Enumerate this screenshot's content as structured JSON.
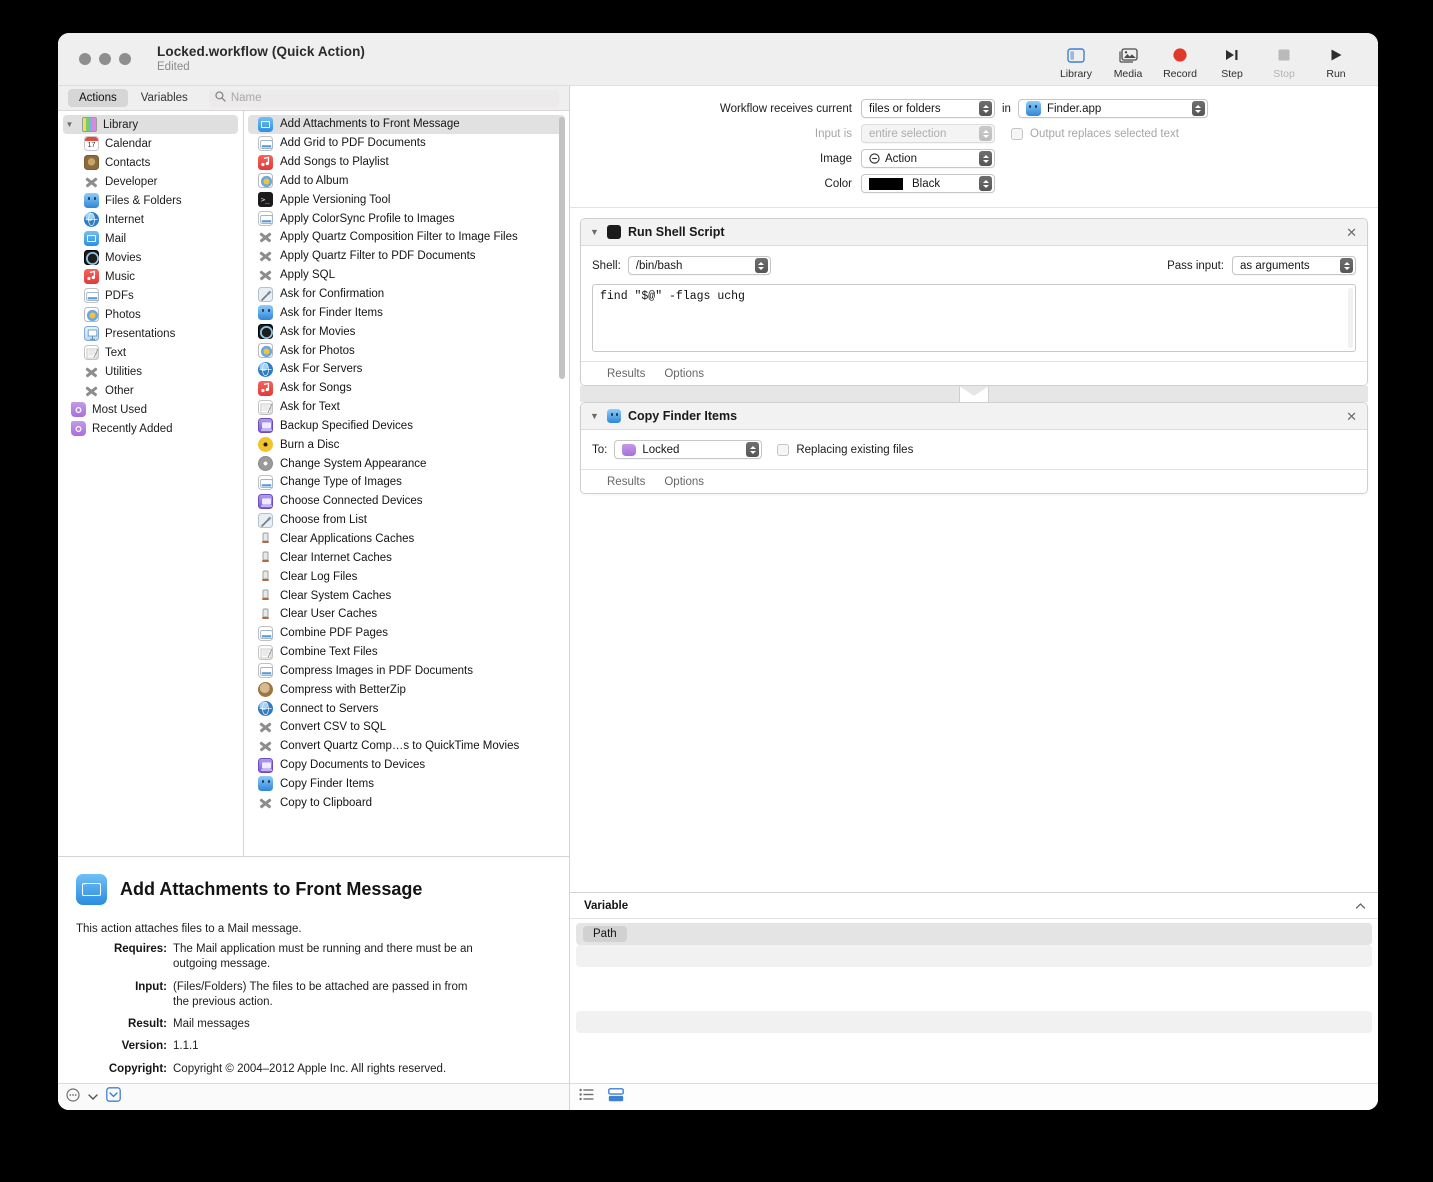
{
  "window": {
    "title": "Locked.workflow (Quick Action)",
    "subtitle": "Edited"
  },
  "toolbar": [
    {
      "label": "Library",
      "icon": "library-icon",
      "disabled": false
    },
    {
      "label": "Media",
      "icon": "media-icon",
      "disabled": false
    },
    {
      "label": "Record",
      "icon": "record-icon",
      "disabled": false
    },
    {
      "label": "Step",
      "icon": "step-icon",
      "disabled": false
    },
    {
      "label": "Stop",
      "icon": "stop-icon",
      "disabled": true
    },
    {
      "label": "Run",
      "icon": "run-icon",
      "disabled": false
    }
  ],
  "tabs": {
    "actions": "Actions",
    "variables": "Variables"
  },
  "search": {
    "placeholder": "Name",
    "value": ""
  },
  "tree": {
    "root": {
      "label": "Library",
      "icon": "library-icon"
    },
    "children": [
      {
        "label": "Calendar",
        "icon": "calendar-icon"
      },
      {
        "label": "Contacts",
        "icon": "contacts-icon"
      },
      {
        "label": "Developer",
        "icon": "x-tool-icon"
      },
      {
        "label": "Files & Folders",
        "icon": "finder-icon"
      },
      {
        "label": "Internet",
        "icon": "globe-icon"
      },
      {
        "label": "Mail",
        "icon": "mail-icon"
      },
      {
        "label": "Movies",
        "icon": "quicktime-icon"
      },
      {
        "label": "Music",
        "icon": "music-icon"
      },
      {
        "label": "PDFs",
        "icon": "pdf-icon"
      },
      {
        "label": "Photos",
        "icon": "photos-icon"
      },
      {
        "label": "Presentations",
        "icon": "presentation-icon"
      },
      {
        "label": "Text",
        "icon": "textedit-icon"
      },
      {
        "label": "Utilities",
        "icon": "x-tool-icon"
      },
      {
        "label": "Other",
        "icon": "x-tool-icon"
      }
    ],
    "groups": [
      {
        "label": "Most Used",
        "icon": "smart-folder-icon"
      },
      {
        "label": "Recently Added",
        "icon": "smart-folder-icon"
      }
    ]
  },
  "actions_list": [
    {
      "label": "Add Attachments to Front Message",
      "icon": "mail-icon",
      "selected": true
    },
    {
      "label": "Add Grid to PDF Documents",
      "icon": "pdf-icon"
    },
    {
      "label": "Add Songs to Playlist",
      "icon": "music-icon"
    },
    {
      "label": "Add to Album",
      "icon": "photos-icon"
    },
    {
      "label": "Apple Versioning Tool",
      "icon": "terminal-icon"
    },
    {
      "label": "Apply ColorSync Profile to Images",
      "icon": "pdf-icon"
    },
    {
      "label": "Apply Quartz Composition Filter to Image Files",
      "icon": "x-tool-icon"
    },
    {
      "label": "Apply Quartz Filter to PDF Documents",
      "icon": "x-tool-icon"
    },
    {
      "label": "Apply SQL",
      "icon": "x-tool-icon"
    },
    {
      "label": "Ask for Confirmation",
      "icon": "wand-icon"
    },
    {
      "label": "Ask for Finder Items",
      "icon": "finder-icon"
    },
    {
      "label": "Ask for Movies",
      "icon": "quicktime-icon"
    },
    {
      "label": "Ask for Photos",
      "icon": "photos-icon"
    },
    {
      "label": "Ask For Servers",
      "icon": "globe-icon"
    },
    {
      "label": "Ask for Songs",
      "icon": "music-icon"
    },
    {
      "label": "Ask for Text",
      "icon": "textedit-icon"
    },
    {
      "label": "Backup Specified Devices",
      "icon": "device-icon"
    },
    {
      "label": "Burn a Disc",
      "icon": "burn-icon"
    },
    {
      "label": "Change System Appearance",
      "icon": "gear-icon"
    },
    {
      "label": "Change Type of Images",
      "icon": "pdf-icon"
    },
    {
      "label": "Choose Connected Devices",
      "icon": "device-icon"
    },
    {
      "label": "Choose from List",
      "icon": "wand-icon"
    },
    {
      "label": "Clear Applications Caches",
      "icon": "trash-icon"
    },
    {
      "label": "Clear Internet Caches",
      "icon": "trash-icon"
    },
    {
      "label": "Clear Log Files",
      "icon": "trash-icon"
    },
    {
      "label": "Clear System Caches",
      "icon": "trash-icon"
    },
    {
      "label": "Clear User Caches",
      "icon": "trash-icon"
    },
    {
      "label": "Combine PDF Pages",
      "icon": "pdf-icon"
    },
    {
      "label": "Combine Text Files",
      "icon": "textedit-icon"
    },
    {
      "label": "Compress Images in PDF Documents",
      "icon": "pdf-icon"
    },
    {
      "label": "Compress with BetterZip",
      "icon": "zip-icon"
    },
    {
      "label": "Connect to Servers",
      "icon": "globe-icon"
    },
    {
      "label": "Convert CSV to SQL",
      "icon": "x-tool-icon"
    },
    {
      "label": "Convert Quartz Comp…s to QuickTime Movies",
      "icon": "x-tool-icon"
    },
    {
      "label": "Copy Documents to Devices",
      "icon": "device-icon"
    },
    {
      "label": "Copy Finder Items",
      "icon": "finder-icon"
    },
    {
      "label": "Copy to Clipboard",
      "icon": "x-tool-icon"
    }
  ],
  "info": {
    "icon": "mail-icon",
    "title": "Add Attachments to Front Message",
    "description": "This action attaches files to a Mail message.",
    "fields": [
      {
        "key": "Requires:",
        "value": "The Mail application must be running and there must be an outgoing message."
      },
      {
        "key": "Input:",
        "value": "(Files/Folders) The files to be attached are passed in from the previous action."
      },
      {
        "key": "Result:",
        "value": "Mail messages"
      },
      {
        "key": "Version:",
        "value": "1.1.1"
      },
      {
        "key": "Copyright:",
        "value": "Copyright © 2004–2012 Apple Inc.  All rights reserved."
      }
    ]
  },
  "status_bar": {
    "options_icon": "options-menu-icon",
    "chevron_icon": "chevron-down-icon",
    "toggle_icon": "description-toggle-icon"
  },
  "workflow_settings": {
    "rows": [
      {
        "label": "Workflow receives current",
        "value": "files or folders",
        "enabled": true
      },
      {
        "label": "Input is",
        "value": "entire selection",
        "enabled": false
      },
      {
        "label": "Image",
        "value": "Action",
        "enabled": true,
        "prefix_icon": "action-dot-icon"
      },
      {
        "label": "Color",
        "value": "Black",
        "enabled": true,
        "swatch": "#000000"
      }
    ],
    "in_label": "in",
    "app": {
      "value": "Finder.app",
      "icon": "finder-icon"
    },
    "output_checkbox": {
      "label": "Output replaces selected text",
      "checked": false,
      "enabled": false
    }
  },
  "action_cards": [
    {
      "title": "Run Shell Script",
      "icon": "terminal-icon",
      "close_icon": "close-icon",
      "disclosure_icon": "chevron-down-icon",
      "controls": {
        "shell_label": "Shell:",
        "shell_value": "/bin/bash",
        "pass_input_label": "Pass input:",
        "pass_input_value": "as arguments"
      },
      "script": "find \"$@\" -flags uchg",
      "footer_tabs": [
        "Results",
        "Options"
      ]
    },
    {
      "title": "Copy Finder Items",
      "icon": "finder-icon",
      "close_icon": "close-icon",
      "disclosure_icon": "chevron-down-icon",
      "controls": {
        "to_label": "To:",
        "to_value": "Locked",
        "to_icon": "folder-icon",
        "replace_label": "Replacing existing files",
        "replace_checked": false
      },
      "footer_tabs": [
        "Results",
        "Options"
      ]
    }
  ],
  "variable_panel": {
    "title": "Variable",
    "collapse_icon": "chevron-up-icon",
    "rows": [
      {
        "chip": "Path"
      },
      {},
      {},
      {},
      {}
    ],
    "footer": {
      "list_icon": "list-view-icon",
      "split_icon": "split-view-icon"
    }
  },
  "colors": {
    "accent": "#3f7fd4",
    "record": "#e0392b",
    "window_bg": "#ffffff",
    "chrome": "#f0efef"
  }
}
